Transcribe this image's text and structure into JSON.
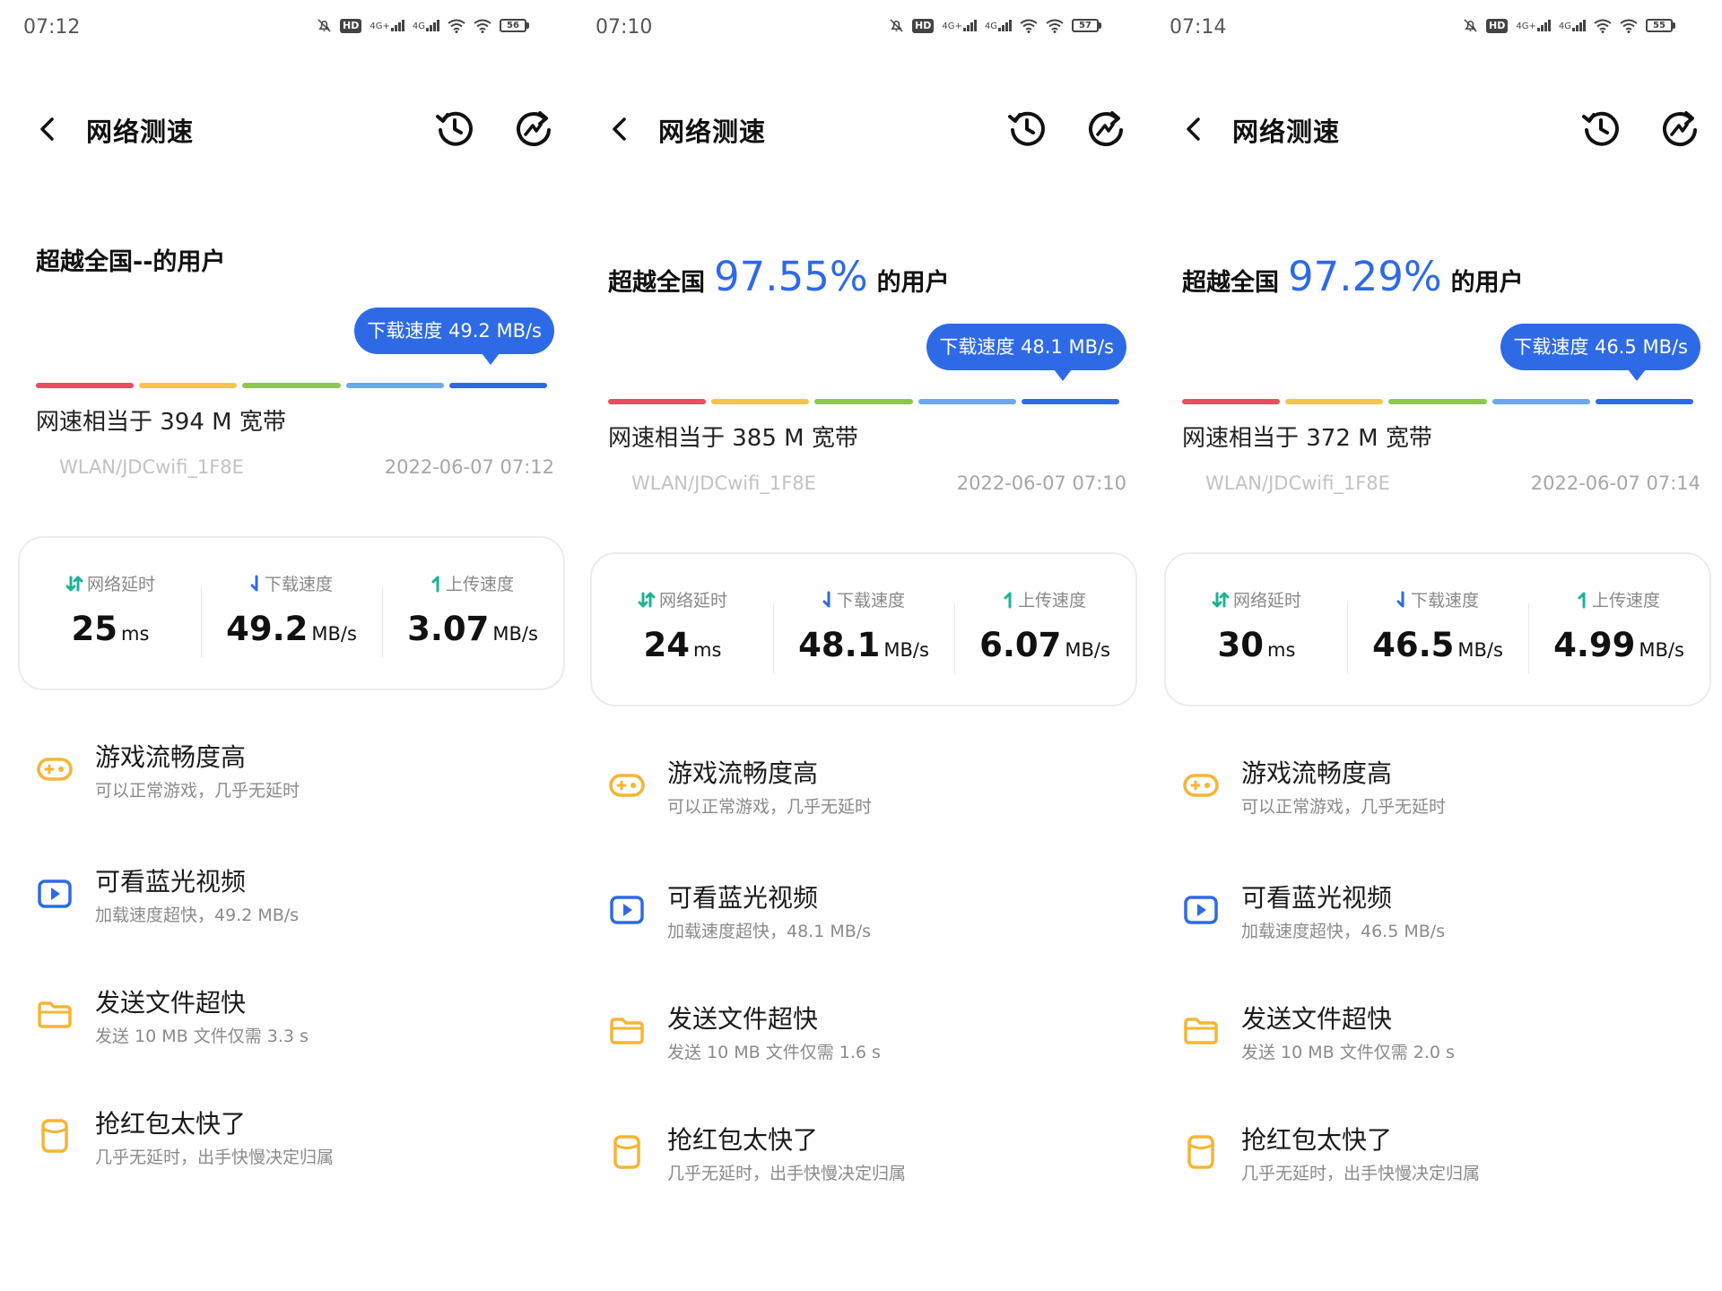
{
  "colors": {
    "accent": "#2e6ae6",
    "rating_segments": [
      "#e94d5f",
      "#f6c548",
      "#8cc84b",
      "#6aa9ec",
      "#2e6ae6"
    ],
    "latency_icon": "#1cb394",
    "download_icon": "#2e6ae6",
    "upload_icon": "#1cb394",
    "feature_icon_orange": "#f5b533",
    "feature_icon_blue": "#2e6ae6"
  },
  "screens": [
    {
      "status": {
        "time": "07:12",
        "battery": "56",
        "hd": "HD",
        "net1": "4G+",
        "net2": "4G"
      },
      "app_bar": {
        "title": "网络测速",
        "back_icon": "chevron-left-icon",
        "history_icon": "history-clock-icon",
        "retest_icon": "refresh-icon"
      },
      "headline": {
        "prefix": "超越全国",
        "percent": "--",
        "suffix": "的用户"
      },
      "tooltip": "下载速度 49.2 MB/s",
      "speed_level": "5 of 5 segments",
      "equivalent": "网速相当于 394 M 宽带",
      "network": "WLAN/JDCwifi_1F8E",
      "timestamp": "2022-06-07 07:12",
      "stats": {
        "latency": {
          "label": "网络延时",
          "value": "25",
          "unit": "ms"
        },
        "download": {
          "label": "下载速度",
          "value": "49.2",
          "unit": "MB/s"
        },
        "upload": {
          "label": "上传速度",
          "value": "3.07",
          "unit": "MB/s"
        }
      },
      "features": [
        {
          "title": "游戏流畅度高",
          "subtitle": "可以正常游戏，几乎无延时",
          "icon": "gamepad-icon"
        },
        {
          "title": "可看蓝光视频",
          "subtitle": "加载速度超快，49.2 MB/s",
          "icon": "video-play-icon"
        },
        {
          "title": "发送文件超快",
          "subtitle": "发送 10 MB 文件仅需 3.3 s",
          "icon": "folder-icon"
        },
        {
          "title": "抢红包太快了",
          "subtitle": "几乎无延时，出手快慢决定归属",
          "icon": "red-packet-icon"
        }
      ]
    },
    {
      "status": {
        "time": "07:10",
        "battery": "57",
        "hd": "HD",
        "net1": "4G+",
        "net2": "4G"
      },
      "app_bar": {
        "title": "网络测速",
        "back_icon": "chevron-left-icon",
        "history_icon": "history-clock-icon",
        "retest_icon": "refresh-icon"
      },
      "headline": {
        "prefix": "超越全国",
        "percent": "97.55%",
        "suffix": "的用户"
      },
      "tooltip": "下载速度 48.1 MB/s",
      "speed_level": "5 of 5 segments",
      "equivalent": "网速相当于 385 M 宽带",
      "network": "WLAN/JDCwifi_1F8E",
      "timestamp": "2022-06-07 07:10",
      "stats": {
        "latency": {
          "label": "网络延时",
          "value": "24",
          "unit": "ms"
        },
        "download": {
          "label": "下载速度",
          "value": "48.1",
          "unit": "MB/s"
        },
        "upload": {
          "label": "上传速度",
          "value": "6.07",
          "unit": "MB/s"
        }
      },
      "features": [
        {
          "title": "游戏流畅度高",
          "subtitle": "可以正常游戏，几乎无延时",
          "icon": "gamepad-icon"
        },
        {
          "title": "可看蓝光视频",
          "subtitle": "加载速度超快，48.1 MB/s",
          "icon": "video-play-icon"
        },
        {
          "title": "发送文件超快",
          "subtitle": "发送 10 MB 文件仅需 1.6 s",
          "icon": "folder-icon"
        },
        {
          "title": "抢红包太快了",
          "subtitle": "几乎无延时，出手快慢决定归属",
          "icon": "red-packet-icon"
        }
      ]
    },
    {
      "status": {
        "time": "07:14",
        "battery": "55",
        "hd": "HD",
        "net1": "4G+",
        "net2": "4G"
      },
      "app_bar": {
        "title": "网络测速",
        "back_icon": "chevron-left-icon",
        "history_icon": "history-clock-icon",
        "retest_icon": "refresh-icon"
      },
      "headline": {
        "prefix": "超越全国",
        "percent": "97.29%",
        "suffix": "的用户"
      },
      "tooltip": "下载速度 46.5 MB/s",
      "speed_level": "5 of 5 segments",
      "equivalent": "网速相当于 372 M 宽带",
      "network": "WLAN/JDCwifi_1F8E",
      "timestamp": "2022-06-07 07:14",
      "stats": {
        "latency": {
          "label": "网络延时",
          "value": "30",
          "unit": "ms"
        },
        "download": {
          "label": "下载速度",
          "value": "46.5",
          "unit": "MB/s"
        },
        "upload": {
          "label": "上传速度",
          "value": "4.99",
          "unit": "MB/s"
        }
      },
      "features": [
        {
          "title": "游戏流畅度高",
          "subtitle": "可以正常游戏，几乎无延时",
          "icon": "gamepad-icon"
        },
        {
          "title": "可看蓝光视频",
          "subtitle": "加载速度超快，46.5 MB/s",
          "icon": "video-play-icon"
        },
        {
          "title": "发送文件超快",
          "subtitle": "发送 10 MB 文件仅需 2.0 s",
          "icon": "folder-icon"
        },
        {
          "title": "抢红包太快了",
          "subtitle": "几乎无延时，出手快慢决定归属",
          "icon": "red-packet-icon"
        }
      ]
    }
  ]
}
